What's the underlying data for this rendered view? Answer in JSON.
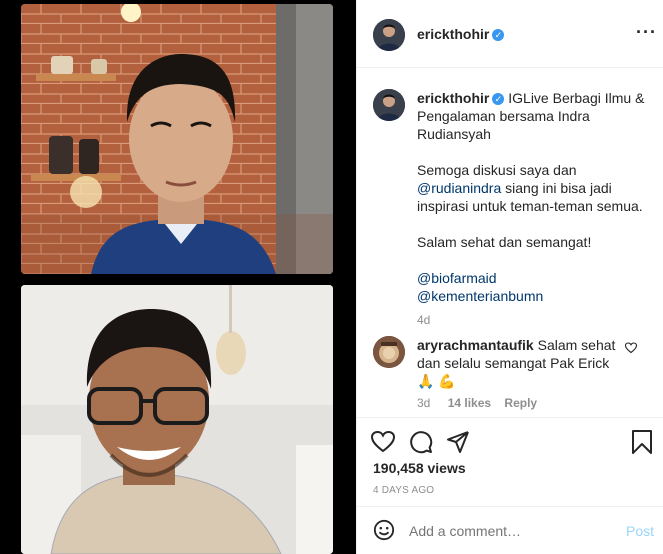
{
  "post": {
    "username": "erickthohir",
    "caption_lead": "IGLive Berbagi Ilmu & Pengalaman bersama Indra Rudiansyah",
    "para1_before": "Semoga diskusi saya dan ",
    "para1_mention": "@rudianindra",
    "para1_after": " siang ini bisa jadi inspirasi untuk teman-teman semua.",
    "para2": "Salam sehat dan semangat!",
    "tag1": "@biofarmaid",
    "tag2": "@kementerianbumn",
    "age": "4d"
  },
  "comment": {
    "username": "aryrachmantaufik",
    "text": "Salam sehat dan selalu semangat Pak Erick 🙏 💪",
    "age": "3d",
    "likes": "14 likes",
    "reply": "Reply"
  },
  "stats": {
    "views": "190,458 views",
    "date": "4 DAYS AGO"
  },
  "add_comment": {
    "placeholder": "Add a comment…",
    "post_label": "Post"
  },
  "colors": {
    "accent": "#0095f6",
    "link": "#00376b",
    "muted": "#8e8e8e",
    "verified": "#3897f0"
  },
  "icons": [
    "more-icon",
    "verified-icon",
    "heart-icon",
    "comment-icon",
    "share-icon",
    "bookmark-icon",
    "emoji-icon"
  ]
}
